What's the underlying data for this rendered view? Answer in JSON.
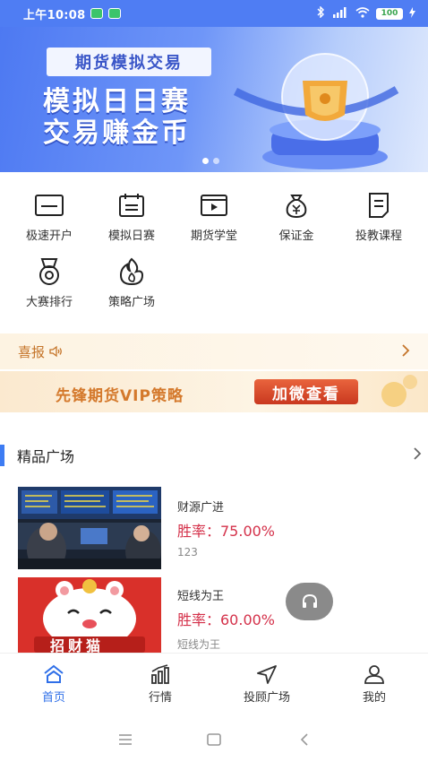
{
  "status_bar": {
    "time": "上午10:08",
    "battery": "100"
  },
  "banner": {
    "tag": "期货模拟交易",
    "line1": "模拟日日赛",
    "line2": "交易赚金币"
  },
  "quick_actions": [
    {
      "label": "极速开户",
      "icon": "card-icon"
    },
    {
      "label": "模拟日赛",
      "icon": "calendar-icon"
    },
    {
      "label": "期货学堂",
      "icon": "video-icon"
    },
    {
      "label": "保证金",
      "icon": "money-bag-icon"
    },
    {
      "label": "投教课程",
      "icon": "document-icon"
    },
    {
      "label": "大赛排行",
      "icon": "medal-icon"
    },
    {
      "label": "策略广场",
      "icon": "flame-icon"
    }
  ],
  "notice": {
    "title": "喜报"
  },
  "promo": {
    "text": "先锋期货VIP策略",
    "button": "加微查看"
  },
  "section": {
    "title": "精品广场"
  },
  "cards": [
    {
      "name": "财源广进",
      "rate": "胜率：75.00%",
      "sub": "123"
    },
    {
      "name": "短线为王",
      "rate": "胜率：60.00%",
      "sub": "短线为王"
    }
  ],
  "thumb_text": {
    "cat_banner": "招财猫"
  },
  "tabs": [
    {
      "label": "首页"
    },
    {
      "label": "行情"
    },
    {
      "label": "投顾广场"
    },
    {
      "label": "我的"
    }
  ],
  "colors": {
    "brand": "#3d7cf3",
    "rate": "#d4314a",
    "notice": "#c5752a"
  }
}
